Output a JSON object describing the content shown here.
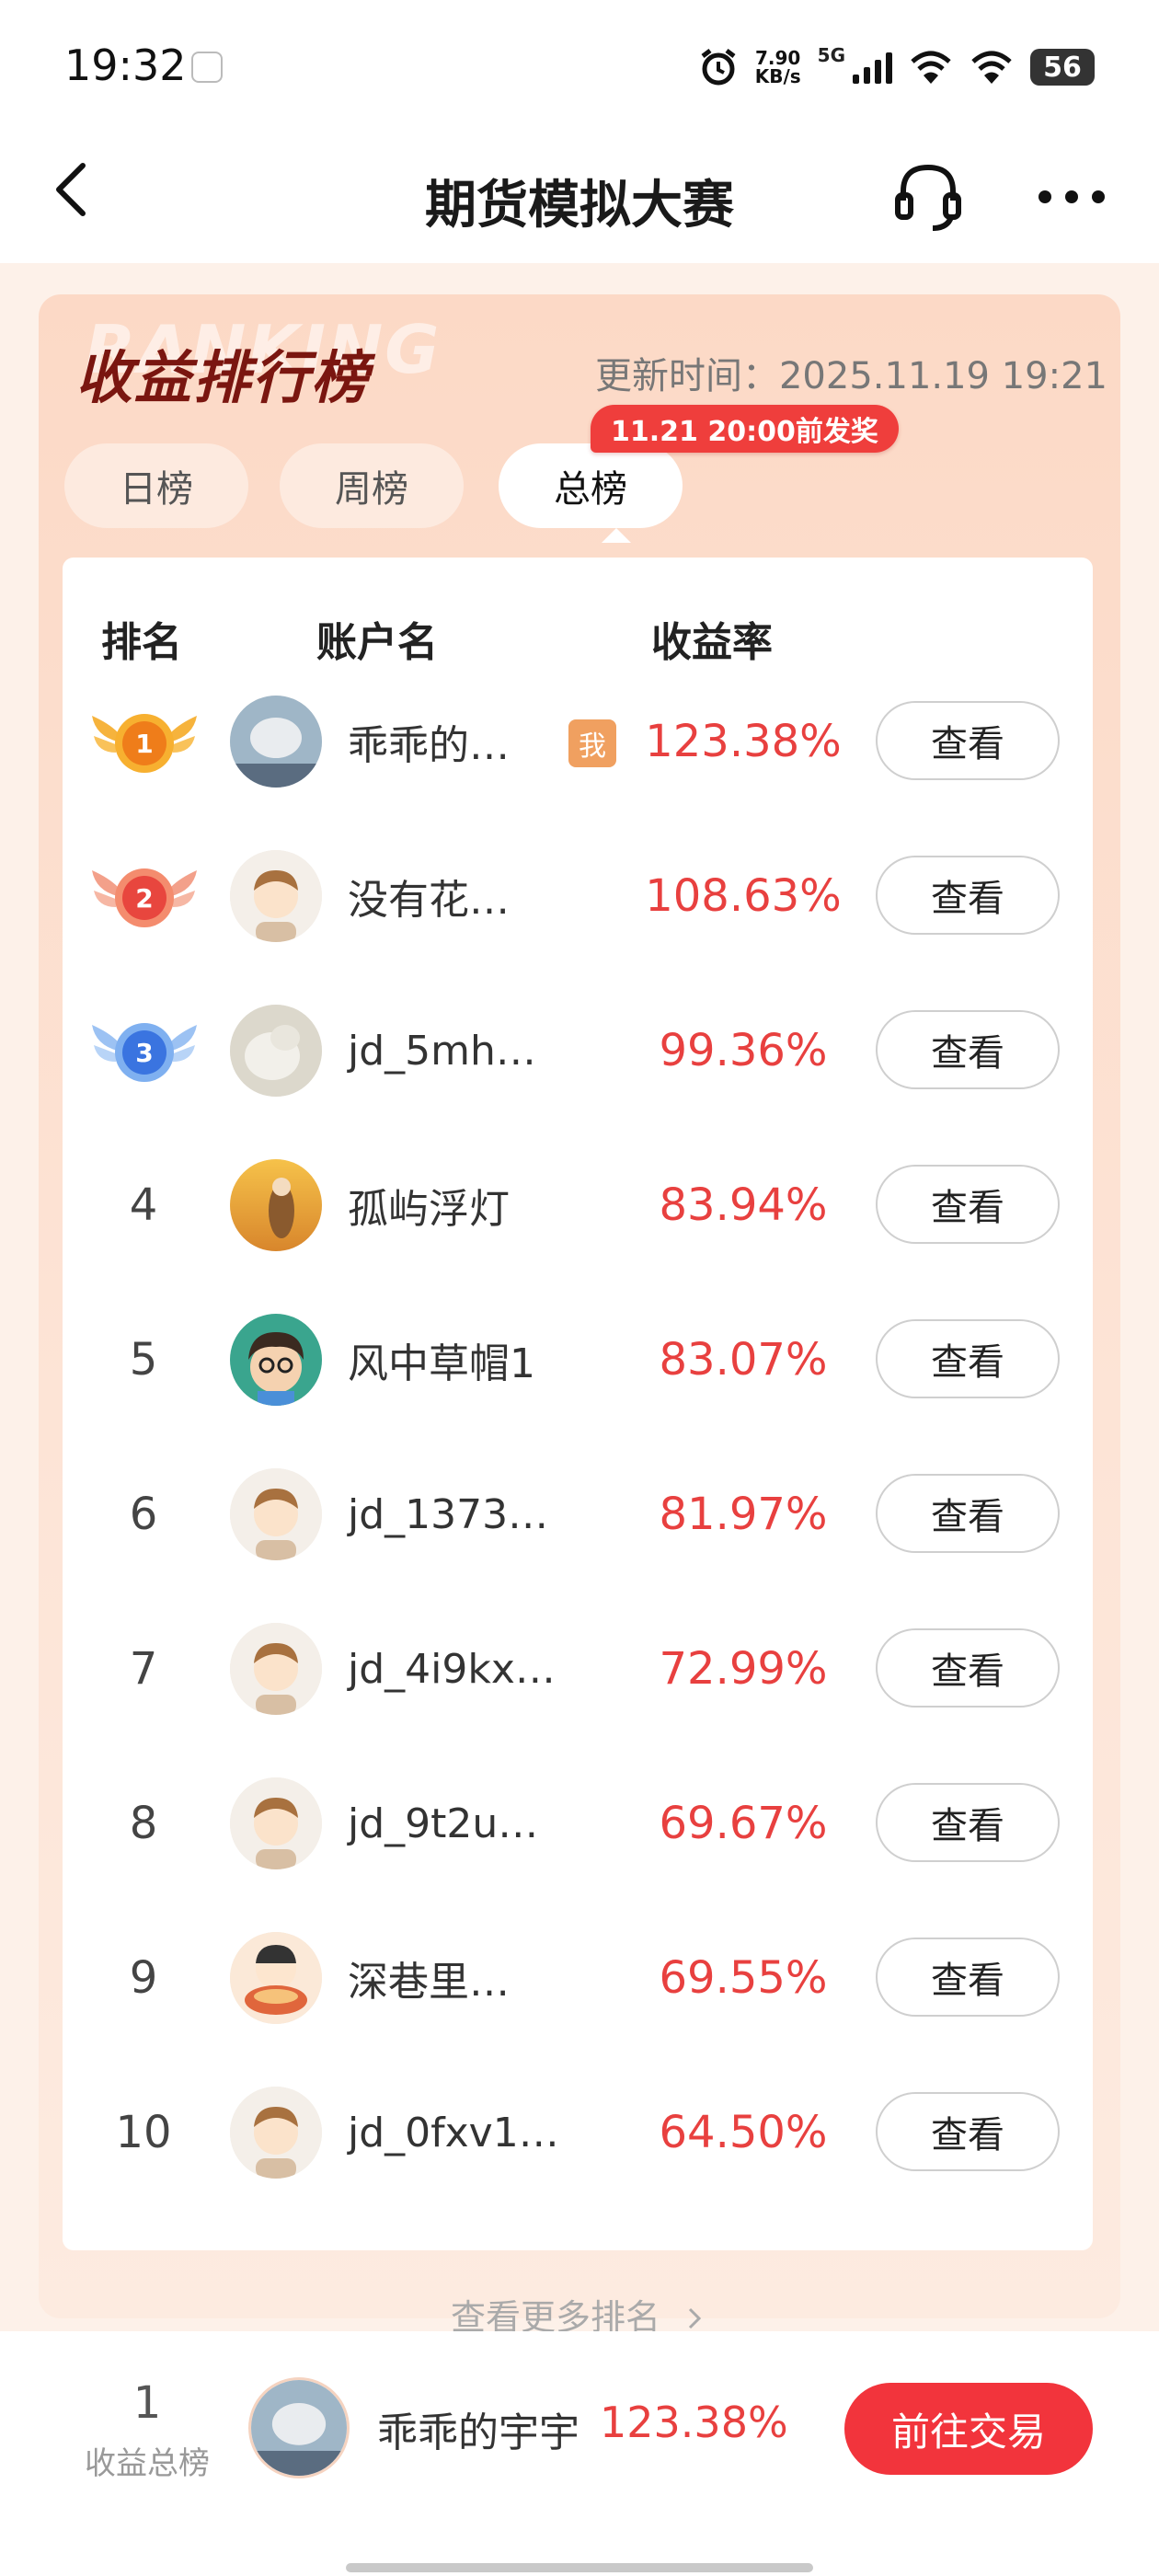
{
  "status_bar": {
    "time": "19:32",
    "net_speed_value": "7.90",
    "net_speed_unit": "KB/s",
    "network_type": "5G",
    "battery": "56"
  },
  "nav": {
    "title": "期货模拟大赛",
    "icons": [
      "back-arrow-icon",
      "headset-icon",
      "more-icon"
    ]
  },
  "board": {
    "watermark": "RANKING",
    "title": "收益排行榜",
    "update_time": "更新时间：2025.11.19 19:21",
    "tabs": [
      {
        "label": "日榜",
        "active": false
      },
      {
        "label": "周榜",
        "active": false
      },
      {
        "label": "总榜",
        "active": true
      }
    ],
    "prize_badge": "11.21 20:00前发奖",
    "columns": {
      "rank": "排名",
      "account": "账户名",
      "rate": "收益率"
    },
    "rows": [
      {
        "rank": "1",
        "medal": "gold",
        "name": "乖乖的…",
        "me": "我",
        "rate": "123.38%",
        "action": "查看"
      },
      {
        "rank": "2",
        "medal": "bronze",
        "name": "没有花…",
        "rate": "108.63%",
        "action": "查看"
      },
      {
        "rank": "3",
        "medal": "blue",
        "name": "jd_5mh…",
        "rate": "99.36%",
        "action": "查看"
      },
      {
        "rank": "4",
        "name": "孤屿浮灯",
        "rate": "83.94%",
        "action": "查看"
      },
      {
        "rank": "5",
        "name": "风中草帽1",
        "rate": "83.07%",
        "action": "查看"
      },
      {
        "rank": "6",
        "name": "jd_1373…",
        "rate": "81.97%",
        "action": "查看"
      },
      {
        "rank": "7",
        "name": "jd_4i9kx…",
        "rate": "72.99%",
        "action": "查看"
      },
      {
        "rank": "8",
        "name": "jd_9t2u…",
        "rate": "69.67%",
        "action": "查看"
      },
      {
        "rank": "9",
        "name": "深巷里…",
        "rate": "69.55%",
        "action": "查看"
      },
      {
        "rank": "10",
        "name": "jd_0fxv1…",
        "rate": "64.50%",
        "action": "查看"
      }
    ],
    "more_link": "查看更多排名"
  },
  "bottom": {
    "rank": "1",
    "rank_label": "收益总榜",
    "name": "乖乖的宇宇",
    "rate": "123.38%",
    "trade_button": "前往交易"
  },
  "colors": {
    "accent_red": "#e8403f",
    "button_red": "#f2343c",
    "board_bg": "#fcd9c6",
    "title_dark_red": "#7a1610"
  }
}
